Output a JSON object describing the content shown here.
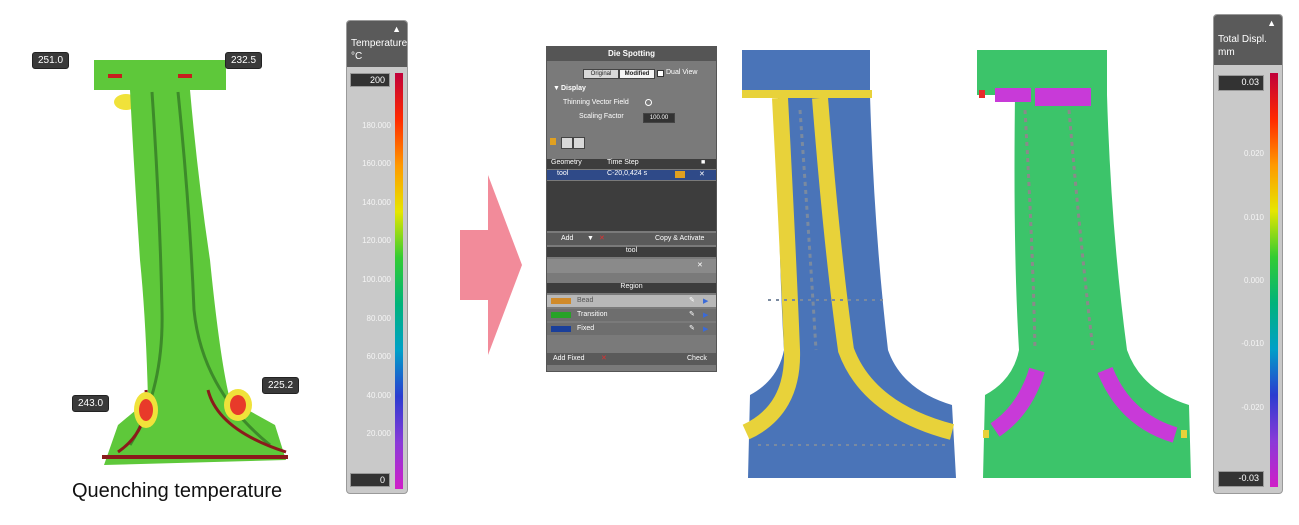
{
  "left_model": {
    "callouts": [
      "251.0",
      "232.5",
      "243.0",
      "225.2"
    ],
    "caption": "Quenching temperature"
  },
  "temp_legend": {
    "title_line1": "Temperature",
    "title_line2": "°C",
    "max_value": "200",
    "min_value": "0",
    "ticks": [
      "180.000",
      "160.000",
      "140.000",
      "120.000",
      "100.000",
      "80.000",
      "60.000",
      "40.000",
      "20.000"
    ],
    "colors": [
      "#c0003a",
      "#ff2a00",
      "#ff9900",
      "#e6e600",
      "#33cc33",
      "#00b37a",
      "#00a0c8",
      "#2b3cd0",
      "#8a3ad8",
      "#d01ec8"
    ]
  },
  "die_panel": {
    "title": "Die Spotting",
    "original_label": "Original",
    "modified_label": "Modified",
    "dual_view_label": "Dual View",
    "display_label": "Display",
    "thinning_label": "Thinning Vector Field",
    "scaling_label": "Scaling Factor",
    "scaling_value": "100.00",
    "col_geometry": "Geometry",
    "col_timestep": "Time Step",
    "row_geometry": "tool",
    "row_timestep": "C-20,0,424 s",
    "add_label": "Add",
    "copy_activate_label": "Copy & Activate",
    "tool_header": "tool",
    "region_header": "Region",
    "regions": [
      {
        "name": "Bead",
        "color": "#d08a2a"
      },
      {
        "name": "Transition",
        "color": "#27a327"
      },
      {
        "name": "Fixed",
        "color": "#1a3f9a"
      }
    ],
    "add_fixed_label": "Add Fixed",
    "check_label": "Check"
  },
  "displ_legend": {
    "title_line1": "Total Displ.",
    "title_line2": "mm",
    "max_value": "0.03",
    "min_value": "-0.03",
    "ticks": [
      "0.020",
      "0.010",
      "0.000",
      "-0.010",
      "-0.020"
    ],
    "colors": [
      "#c0003a",
      "#ff2a00",
      "#ff9900",
      "#e6e600",
      "#33cc33",
      "#00b37a",
      "#00a0c8",
      "#2b3cd0",
      "#8a3ad8",
      "#d01ec8"
    ]
  }
}
